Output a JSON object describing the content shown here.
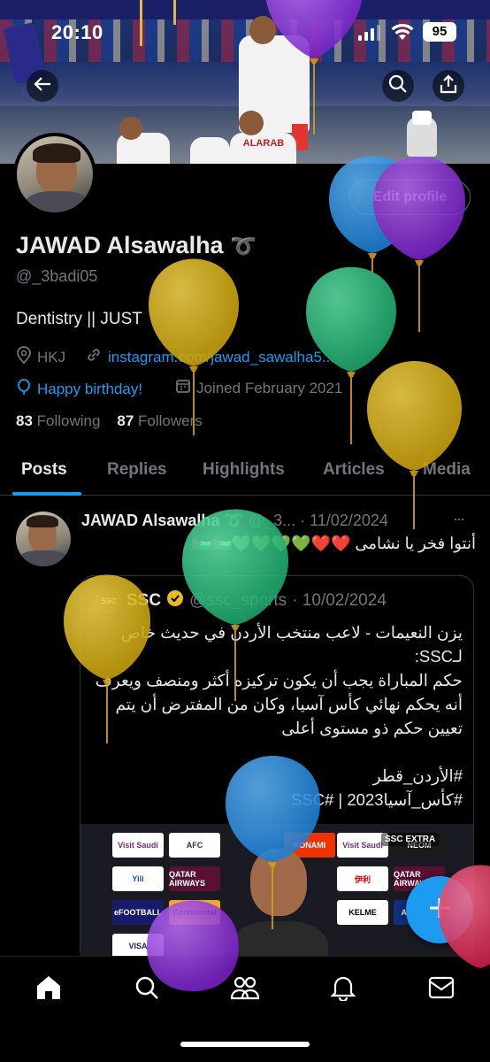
{
  "status_bar": {
    "time": "20:10",
    "battery": "95"
  },
  "profile": {
    "name": "JAWAD Alsawalha",
    "name_emoji": "➰",
    "handle": "@_3badi05",
    "bio": "Dentistry || JUST",
    "location": "HKJ",
    "link": "instagram.com/jawad_sawalha5...",
    "birthday": "Happy birthday!",
    "joined": "Joined February 2021",
    "edit_label": "Edit profile",
    "following_count": "83",
    "following_label": "Following",
    "followers_count": "87",
    "followers_label": "Followers"
  },
  "tabs": [
    {
      "label": "Posts",
      "active": true
    },
    {
      "label": "Replies"
    },
    {
      "label": "Highlights"
    },
    {
      "label": "Articles"
    },
    {
      "label": "Media"
    }
  ],
  "post": {
    "author": "JAWAD Alsawalha",
    "author_emoji": "➰",
    "handle": "@_3...",
    "date": "· 11/02/2024",
    "more": "···",
    "text": "أنتوا فخر يا نشامى ❤️❤️💚💚💚💚🇯🇴🇯🇴",
    "quote": {
      "avatar_text": "SSC",
      "name": "SSC",
      "handle": "@ssc_sports",
      "date": "· 10/02/2024",
      "text": "يزن النعيمات - لاعب منتخب الأردن في حديث خاص لـSSC:\nحكم المباراة يجب أن يكون تركيزه أكثر ومنصف ويعرف أنه يحكم نهائي كأس آسيا، وكان من المفترض أن يتم تعيين حكم ذو مستوى أعلى\n\n#الأردن_قطر\n#كأس_آسيا2023 | #SSC",
      "media_sponsors": [
        "Visit Saudi",
        "QATAR AIRWAYS",
        "KONAMI",
        "NEOM",
        "Yili",
        "伊利",
        "KELME",
        "VISA",
        "AFC LIVE",
        "eFOOTBALL",
        "Continental",
        "AFC"
      ],
      "media_badge": "SSC EXTRA"
    }
  },
  "nav": [
    "home-icon",
    "search-icon",
    "communities-icon",
    "notifications-icon",
    "messages-icon"
  ],
  "colors": {
    "accent": "#1d9bf0",
    "bg": "#000000",
    "muted": "#71767b"
  }
}
